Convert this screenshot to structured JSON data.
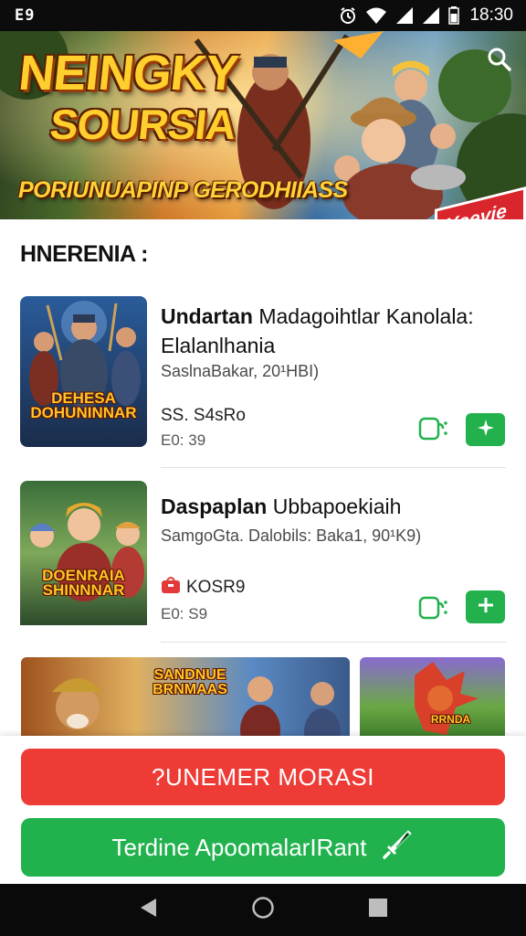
{
  "status_bar": {
    "left_label": "E9",
    "time": "18:30",
    "icons": [
      "alarm-icon",
      "wifi-icon",
      "signal-icon",
      "signal-icon",
      "battery-icon"
    ]
  },
  "hero": {
    "title_line1": "NEINGKY",
    "title_line2": "SOURSIA",
    "subtitle": "PORIUNUAPINP GERODHIIASS",
    "badge": "Yoevie",
    "search_icon": "search-icon"
  },
  "section": {
    "title": "HNERENIA :"
  },
  "games": [
    {
      "thumb_caption": "DEHESA DOHUNINNAR",
      "title_bold": "Undartan",
      "title_rest": "Madagoihtlar Kanolala:",
      "title_line2": "Elalanlhania",
      "meta": "SaslnaBakar, 20¹HBI)",
      "price": "SS. S4sRo",
      "sub": "E0: 39",
      "price_icon": "",
      "outline_icon": "app-icon",
      "add_icon": "sparkle-icon"
    },
    {
      "thumb_caption": "DOENRAIA SHINNNAR",
      "title_bold": "Daspaplan",
      "title_rest": "Ubbapoekiaih",
      "title_line2": "",
      "meta": "SamgoGta. Dalobils: Baka1, 90¹K9)",
      "price": "KOSR9",
      "sub": "E0: S9",
      "price_icon": "shopping-bag-icon",
      "outline_icon": "app-icon",
      "add_icon": "plus-icon"
    }
  ],
  "previews": [
    {
      "caption": "SANDNUE BRNMAAS"
    },
    {
      "caption": "RRNDA"
    }
  ],
  "actions": {
    "primary_label": "?UNEMER MORASI",
    "secondary_label": "Terdine ApoomalarIRant",
    "secondary_icon": "sword-icon"
  },
  "colors": {
    "accent_red": "#ef3b36",
    "accent_green": "#21b24e",
    "hero_title": "#ffcf2e"
  }
}
